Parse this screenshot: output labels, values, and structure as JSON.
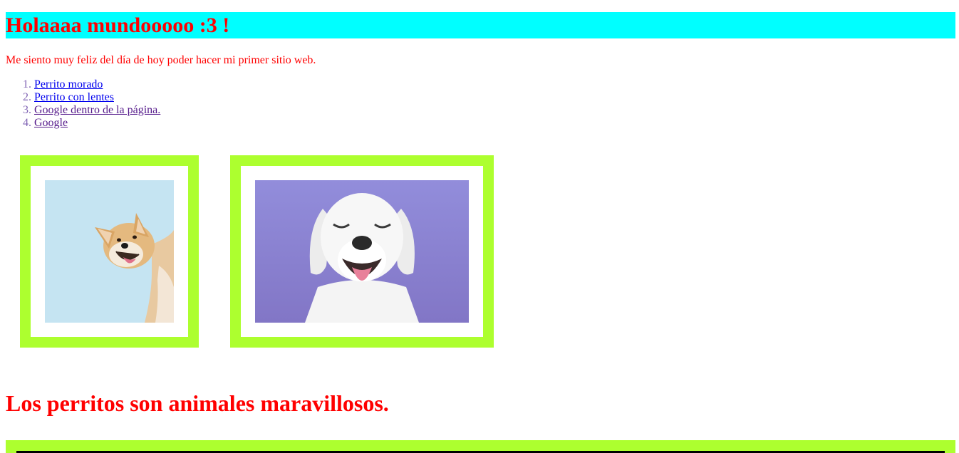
{
  "header": {
    "title": "Holaaaa mundooooo :3 !",
    "background_color": "#00ffff",
    "text_color": "#ff0000"
  },
  "intro": {
    "text": "Me siento muy feliz del día de hoy poder hacer mi primer sitio web."
  },
  "links": {
    "items": [
      {
        "label": "Perrito morado",
        "state": "unvisited"
      },
      {
        "label": "Perrito con lentes",
        "state": "unvisited"
      },
      {
        "label": "Google dentro de la página.",
        "state": "visited"
      },
      {
        "label": "Google",
        "state": "visited"
      }
    ]
  },
  "gallery": {
    "frame_color": "#adff2f",
    "photos": [
      {
        "subject": "shiba-inu-dog-peeking",
        "background": "#c5e4f2"
      },
      {
        "subject": "white-puppy-smiling",
        "background": "#8a80d0"
      }
    ]
  },
  "secondary": {
    "heading": "Los perritos son animales maravillosos."
  },
  "colors": {
    "accent_red": "#ff0000",
    "frame_green": "#adff2f",
    "cyan": "#00ffff",
    "link_blue": "#0000ee",
    "link_visited": "#551a8b"
  }
}
